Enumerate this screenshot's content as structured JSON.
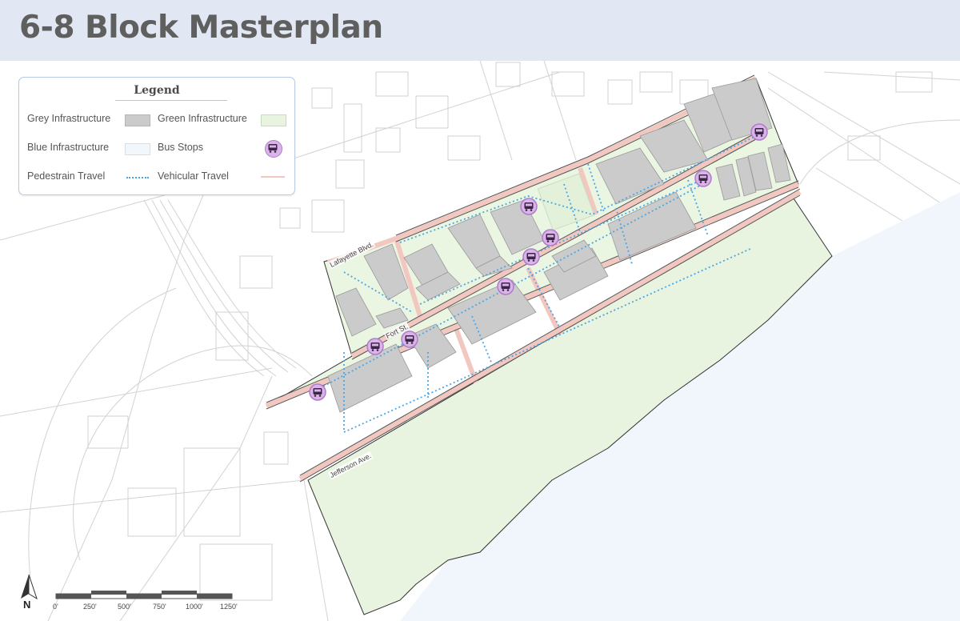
{
  "title": "6-8 Block Masterplan",
  "legend": {
    "title": "Legend",
    "grey": "Grey Infrastructure",
    "green": "Green Infrastructure",
    "blue": "Blue Infrastructure",
    "bus": "Bus Stops",
    "pedestrian": "Pedestrain Travel",
    "vehicular": "Vehicular Travel"
  },
  "streets": {
    "lafayette": "Lafayette Blvd.",
    "fort": "Fort St.",
    "jefferson": "Jefferson Ave."
  },
  "scale": {
    "labels": [
      "0'",
      "250'",
      "500'",
      "750'",
      "1000'",
      "1250'"
    ]
  },
  "north_label": "N",
  "colors": {
    "header_bg": "#e1e8f3",
    "grey_infrastructure": "#cbcbcb",
    "green_infrastructure": "#e8f4e0",
    "blue_infrastructure": "#f2f7fc",
    "pedestrian_travel": "#4aa7e6",
    "vehicular_travel": "#f2c7c0",
    "bus_stop": "#d9b3ea"
  },
  "icons": {
    "bus_stop": "bus-icon",
    "north_arrow": "north-arrow-icon"
  },
  "bus_stop_count": 9
}
